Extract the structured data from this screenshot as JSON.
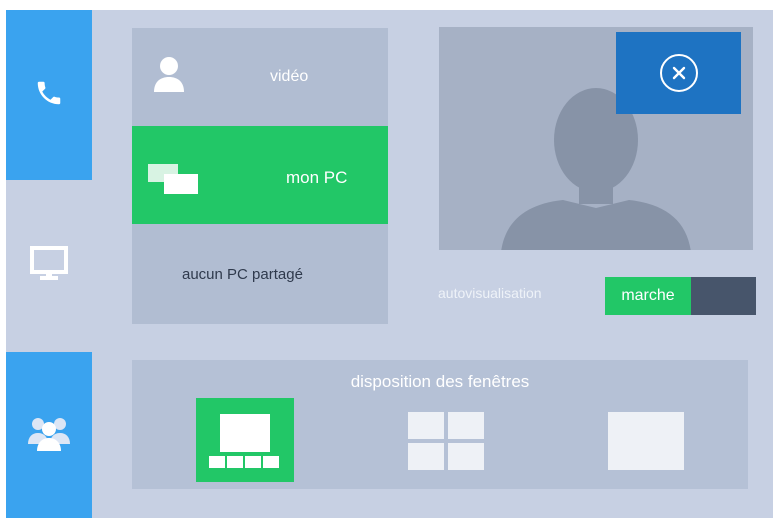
{
  "sources": {
    "video": "vidéo",
    "my_pc": "mon PC",
    "none_shared": "aucun PC partagé"
  },
  "self_view": {
    "label": "autovisualisation",
    "toggle_on": "marche"
  },
  "layout": {
    "title": "disposition des fenêtres"
  },
  "icons": [
    "phone-icon",
    "monitor-icon",
    "group-icon",
    "person-icon",
    "windows-icon",
    "close-icon",
    "avatar-silhouette"
  ],
  "colors": {
    "background": "#c7d0e3",
    "rail_active": "#3aa3ef",
    "accent_green": "#22c767",
    "close_blue": "#1e73c2",
    "toggle_off": "#47556b"
  }
}
